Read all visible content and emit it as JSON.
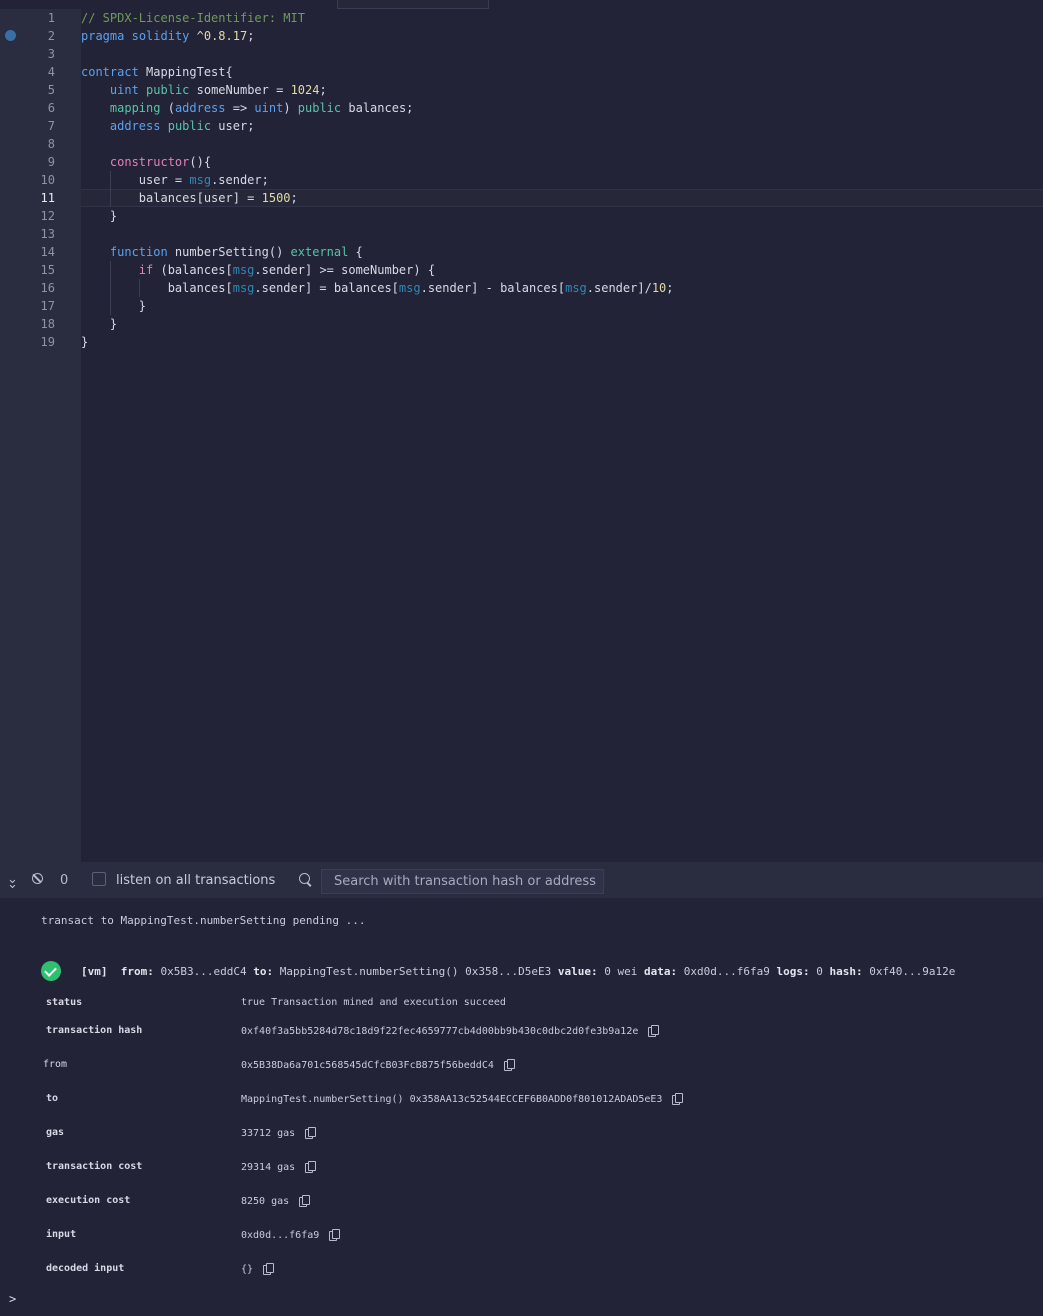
{
  "editor": {
    "active_line": 11,
    "breakpoint_line": 2,
    "line_numbers": [
      "1",
      "2",
      "3",
      "4",
      "5",
      "6",
      "7",
      "8",
      "9",
      "10",
      "11",
      "12",
      "13",
      "14",
      "15",
      "16",
      "17",
      "18",
      "19"
    ],
    "lines": [
      [
        [
          "c",
          "// SPDX-License-Identifier: MIT"
        ]
      ],
      [
        [
          "k",
          "pragma"
        ],
        [
          "o",
          " "
        ],
        [
          "k",
          "solidity"
        ],
        [
          "o",
          " "
        ],
        [
          "n",
          "^0.8.17"
        ],
        [
          "o",
          ";"
        ]
      ],
      [],
      [
        [
          "k",
          "contract"
        ],
        [
          "o",
          " MappingTest{"
        ]
      ],
      [
        [
          "o",
          "    "
        ],
        [
          "k",
          "uint"
        ],
        [
          "o",
          " "
        ],
        [
          "t",
          "public"
        ],
        [
          "o",
          " someNumber = "
        ],
        [
          "n",
          "1024"
        ],
        [
          "o",
          ";"
        ]
      ],
      [
        [
          "o",
          "    "
        ],
        [
          "t",
          "mapping"
        ],
        [
          "o",
          " ("
        ],
        [
          "k",
          "address"
        ],
        [
          "o",
          " => "
        ],
        [
          "k",
          "uint"
        ],
        [
          "o",
          ") "
        ],
        [
          "t",
          "public"
        ],
        [
          "o",
          " balances;"
        ]
      ],
      [
        [
          "o",
          "    "
        ],
        [
          "k",
          "address"
        ],
        [
          "o",
          " "
        ],
        [
          "t",
          "public"
        ],
        [
          "o",
          " user;"
        ]
      ],
      [],
      [
        [
          "o",
          "    "
        ],
        [
          "p",
          "constructor"
        ],
        [
          "o",
          "(){"
        ]
      ],
      [
        [
          "o",
          "        user = "
        ],
        [
          "m",
          "msg"
        ],
        [
          "o",
          ".sender;"
        ]
      ],
      [
        [
          "o",
          "        balances[user] = "
        ],
        [
          "n",
          "1500"
        ],
        [
          "o",
          ";"
        ]
      ],
      [
        [
          "o",
          "    }"
        ]
      ],
      [],
      [
        [
          "o",
          "    "
        ],
        [
          "k",
          "function"
        ],
        [
          "o",
          " numberSetting() "
        ],
        [
          "t",
          "external"
        ],
        [
          "o",
          " {"
        ]
      ],
      [
        [
          "o",
          "        "
        ],
        [
          "p",
          "if"
        ],
        [
          "o",
          " (balances["
        ],
        [
          "m",
          "msg"
        ],
        [
          "o",
          ".sender] >= someNumber) {"
        ]
      ],
      [
        [
          "o",
          "            balances["
        ],
        [
          "m",
          "msg"
        ],
        [
          "o",
          ".sender] = balances["
        ],
        [
          "m",
          "msg"
        ],
        [
          "o",
          ".sender] - balances["
        ],
        [
          "m",
          "msg"
        ],
        [
          "o",
          ".sender]/"
        ],
        [
          "n",
          "10"
        ],
        [
          "o",
          ";"
        ]
      ],
      [
        [
          "o",
          "        }"
        ]
      ],
      [
        [
          "o",
          "    }"
        ]
      ],
      [
        [
          "o",
          "}"
        ]
      ]
    ]
  },
  "terminal_bar": {
    "count": "0",
    "listen_label": "listen on all transactions",
    "search_placeholder": "Search with transaction hash or address"
  },
  "terminal": {
    "pending": "transact to MappingTest.numberSetting pending ...",
    "tx_summary": {
      "vm": "[vm]",
      "from_label": "from:",
      "from": "0x5B3...eddC4",
      "to_label": "to:",
      "to": "MappingTest.numberSetting() 0x358...D5eE3",
      "value_label": "value:",
      "value": "0 wei",
      "data_label": "data:",
      "data": "0xd0d...f6fa9",
      "logs_label": "logs:",
      "logs": "0",
      "hash_label": "hash:",
      "hash": "0xf40...9a12e"
    },
    "details": [
      {
        "key": "status",
        "value": "true Transaction mined and execution succeed",
        "copy": false,
        "bold": true
      },
      {
        "key": "transaction hash",
        "value": "0xf40f3a5bb5284d78c18d9f22fec4659777cb4d00bb9b430c0dbc2d0fe3b9a12e",
        "copy": true,
        "bold": true
      },
      {
        "key": "from",
        "value": "0x5B38Da6a701c568545dCfcB03FcB875f56beddC4",
        "copy": true,
        "bold": false
      },
      {
        "key": "to",
        "value": "MappingTest.numberSetting() 0x358AA13c52544ECCEF6B0ADD0f801012ADAD5eE3",
        "copy": true,
        "bold": true
      },
      {
        "key": "gas",
        "value": "33712 gas",
        "copy": true,
        "bold": true
      },
      {
        "key": "transaction cost",
        "value": "29314 gas",
        "copy": true,
        "bold": true
      },
      {
        "key": "execution cost",
        "value": "8250 gas",
        "copy": true,
        "bold": true
      },
      {
        "key": "input",
        "value": "0xd0d...f6fa9",
        "copy": true,
        "bold": true
      },
      {
        "key": "decoded input",
        "value": "{}",
        "copy": true,
        "bold": true
      }
    ],
    "prompt": ">"
  },
  "colors": {
    "background": "#222336",
    "gutter": "#2a2c3f",
    "success": "#2fbf71",
    "breakpoint": "#3a6ea5"
  }
}
